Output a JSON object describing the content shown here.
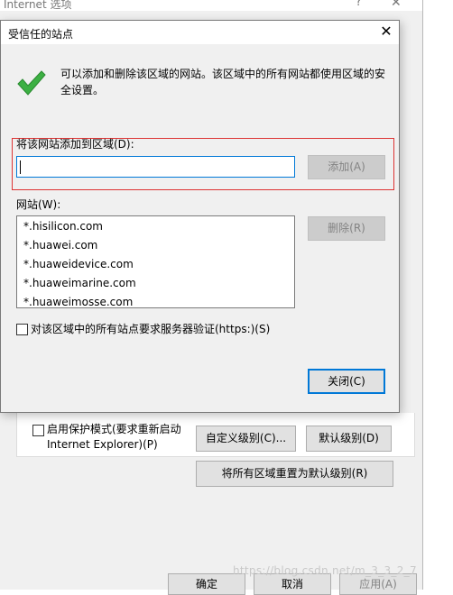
{
  "background_window": {
    "title": "Internet 选项",
    "help_glyph": "?",
    "close_glyph": "✕",
    "protected_mode_label": "启用保护模式(要求重新启动 Internet Explorer)(P)",
    "custom_level_label": "自定义级别(C)...",
    "default_level_label": "默认级别(D)",
    "reset_all_label": "将所有区域重置为默认级别(R)",
    "ok_label": "确定",
    "cancel_label": "取消",
    "apply_label": "应用(A)",
    "watermark": "https://blog.csdn.net/m_3_3_2_7"
  },
  "dialog": {
    "title": "受信任的站点",
    "close_glyph": "✕",
    "info_text": "可以添加和删除该区域的网站。该区域中的所有网站都使用区域的安全设置。",
    "add_label": "将该网站添加到区域(D):",
    "url_input_value": "",
    "add_button": "添加(A)",
    "websites_label": "网站(W):",
    "sites": [
      "*.hisilicon.com",
      "*.huawei.com",
      "*.huaweidevice.com",
      "*.huaweimarine.com",
      "*.huaweimosse.com"
    ],
    "remove_button": "删除(R)",
    "https_label": "对该区域中的所有站点要求服务器验证(https:)(S)",
    "https_checked": false,
    "close_button": "关闭(C)"
  },
  "colors": {
    "accent": "#0078d7",
    "highlight_border": "#dd3333",
    "check_green": "#3cb043"
  },
  "icons": {
    "success": "check-icon",
    "scroll_up": "chevron-up-icon",
    "scroll_down": "chevron-down-icon"
  }
}
